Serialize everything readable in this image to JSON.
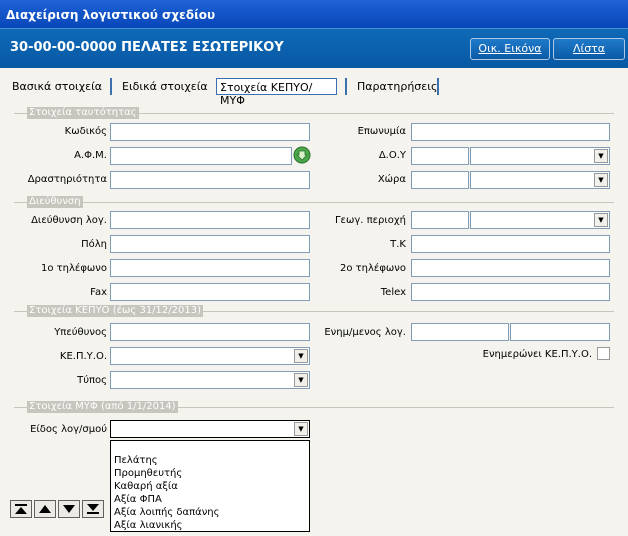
{
  "window": {
    "title": "Διαχείριση λογιστικού σχεδίου"
  },
  "header": {
    "account": "30-00-00-0000 ΠΕΛΑΤΕΣ ΕΣΩΤΕΡΙΚΟΥ",
    "btn_image": "Οικ. Εικόνα",
    "btn_list": "Λίστα"
  },
  "tabs": [
    "Βασικά στοιχεία",
    "Ειδικά στοιχεία",
    "Στοιχεία ΚΕΠΥΟ/ΜΥΦ",
    "Παρατηρήσεις"
  ],
  "sections": {
    "identity": "Στοιχεία ταυτότητας",
    "address": "Διεύθυνση",
    "kepyo": "Στοιχεία ΚΕΠΥΟ (έως 31/12/2013)",
    "myf": "Στοιχεία ΜΥΦ (από 1/1/2014)"
  },
  "labels": {
    "code": "Κωδικός",
    "afm": "Α.Φ.Μ.",
    "activity": "Δραστηριότητα",
    "name": "Επωνυμία",
    "doy": "Δ.Ο.Υ",
    "country": "Χώρα",
    "address": "Διεύθυνση λογ.",
    "city": "Πόλη",
    "phone1": "1ο τηλέφωνο",
    "fax": "Fax",
    "geo": "Γεωγ. περιοχή",
    "tk": "Τ.Κ",
    "phone2": "2ο τηλέφωνο",
    "telex": "Telex",
    "responsible": "Υπεύθυνος",
    "kepyo": "ΚΕ.Π.Υ.Ο.",
    "type": "Τύπος",
    "upd_acc": "Ενημ/μενος λογ.",
    "upd_kepyo": "Ενημερώνει ΚΕ.Π.Υ.Ο.",
    "kind": "Είδος λογ/σμού"
  },
  "dropdown_options": [
    "",
    "Πελάτης",
    "Προμηθευτής",
    "Καθαρή αξία",
    "Αξία ΦΠΑ",
    "Αξία λοιπής δαπάνης",
    "Αξία λιανικής"
  ],
  "icons": {
    "lookup": "green-arrow-down-icon",
    "nav": [
      "first-icon",
      "previous-icon",
      "next-icon",
      "last-icon"
    ]
  }
}
